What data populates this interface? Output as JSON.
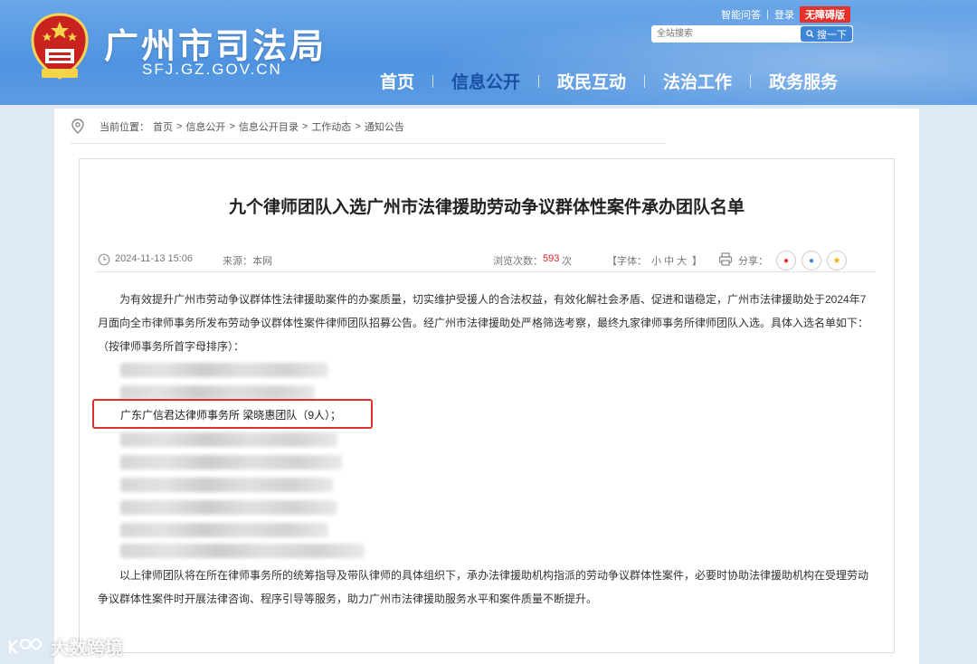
{
  "header": {
    "site_title": "广州市司法局",
    "site_domain": "SFJ.GZ.GOV.CN",
    "links": {
      "qa": "智能问答",
      "sep": "|",
      "login": "登录",
      "accessible": "无障碍版"
    },
    "search": {
      "placeholder": "全站搜索",
      "button": "搜一下"
    },
    "nav": [
      "首页",
      "信息公开",
      "政民互动",
      "法治工作",
      "政务服务"
    ],
    "nav_active_index": 1
  },
  "breadcrumb": {
    "prefix": "当前位置：",
    "items": [
      "首页",
      "信息公开",
      "信息公开目录",
      "工作动态",
      "通知公告"
    ],
    "separator": ">"
  },
  "article": {
    "title": "九个律师团队入选广州市法律援助劳动争议群体性案件承办团队名单",
    "date": "2024-11-13 15:06",
    "source": "来源：本网",
    "views_label": "浏览次数：",
    "views": "593",
    "views_unit": "次",
    "font_label": "【字体：",
    "font_sizes": "小 中 大",
    "font_end": "】",
    "share_label": "分享：",
    "para1": "为有效提升广州市劳动争议群体性法律援助案件的办案质量，切实维护受援人的合法权益，有效化解社会矛盾、促进和谐稳定，广州市法律援助处于2024年7月面向全市律师事务所发布劳动争议群体性案件律师团队招募公告。经广州市法律援助处严格筛选考察，最终九家律师事务所律师团队入选。具体入选名单如下：（按律师事务所首字母排序）：",
    "highlighted_entry": "广东广信君达律师事务所 梁晓惠团队（9人）；",
    "para2": "以上律师团队将在所在律师事务所的统筹指导及带队律师的具体组织下，承办法律援助机构指派的劳动争议群体性案件，必要时协助法律援助机构在受理劳动争议群体性案件时开展法律咨询、程序引导等服务，助力广州市法律援助服务水平和案件质量不断提升。"
  },
  "watermark": "大数跨境",
  "colors": {
    "header_blue": "#4f93e0",
    "active_nav": "#1a4fa3",
    "highlight_red": "#e0302a",
    "accessible_red": "#e4322b"
  }
}
